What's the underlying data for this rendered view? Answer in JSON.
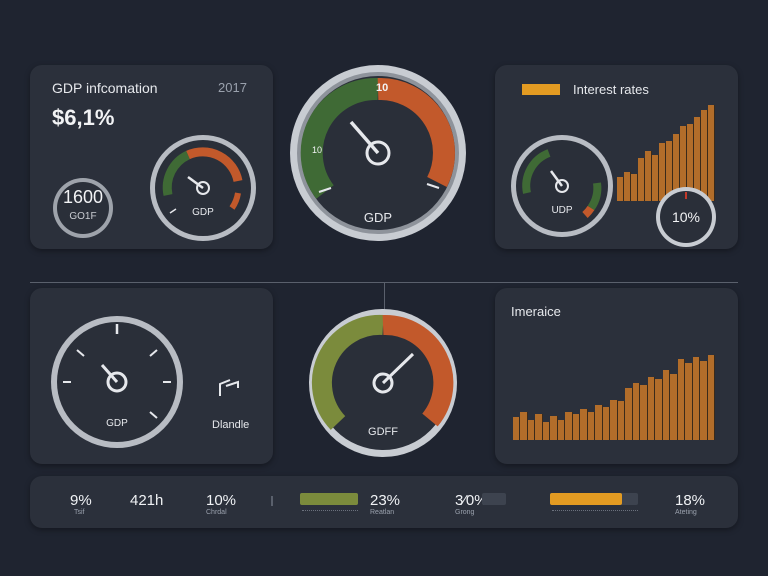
{
  "colors": {
    "background": "#1f2430",
    "panel": "#2b303b",
    "green": "#4d7a3c",
    "olive": "#7b8b3c",
    "orange": "#c2592b",
    "amber": "#e39b22",
    "bar_brown": "#b26d2a"
  },
  "top_left": {
    "title": "GDP infcomation",
    "year": "2017",
    "value": "$6,1%",
    "small_gauge": {
      "value": "1600",
      "label": "GO1F"
    },
    "gauge": {
      "label": "GDP",
      "level": 0.45
    }
  },
  "center_top": {
    "gauge": {
      "label": "GDP",
      "top_tick": "10",
      "left_tick": "10",
      "level": 0.3
    }
  },
  "top_right": {
    "title": "Interest rates",
    "legend_icon": "orange-bar-icon",
    "gauge": {
      "label": "UDP",
      "level": 0.42
    },
    "small_gauge": {
      "value": "10%"
    },
    "bars": [
      0.25,
      0.3,
      0.28,
      0.45,
      0.52,
      0.48,
      0.6,
      0.62,
      0.7,
      0.78,
      0.8,
      0.88,
      0.95,
      1.0
    ]
  },
  "bottom_left": {
    "gauge": {
      "label": "GDP",
      "level": 0.38
    },
    "side_label": "Dlandle",
    "side_icon": "handle-icon"
  },
  "center_bottom": {
    "gauge": {
      "label": "GDFF",
      "level": 0.7
    }
  },
  "bottom_right": {
    "title": "Imeraice",
    "bars": [
      0.25,
      0.3,
      0.22,
      0.28,
      0.2,
      0.26,
      0.22,
      0.3,
      0.28,
      0.34,
      0.3,
      0.38,
      0.36,
      0.44,
      0.42,
      0.56,
      0.62,
      0.6,
      0.68,
      0.66,
      0.76,
      0.72,
      0.88,
      0.84,
      0.9,
      0.86,
      0.92
    ]
  },
  "stats": [
    {
      "value": "9%",
      "label": "Tsif"
    },
    {
      "value": "421h",
      "label": ""
    },
    {
      "value": "10%",
      "label": "Chrdal"
    },
    {
      "value": "23%",
      "label": "Reatlan"
    },
    {
      "value": "3⁄0%",
      "label": "Grong"
    },
    {
      "value": "18%",
      "label": "Ateting"
    }
  ],
  "progress": [
    {
      "name": "green",
      "level": 1.0
    },
    {
      "name": "dark",
      "level": 0.0
    },
    {
      "name": "amber",
      "level": 0.82
    }
  ]
}
